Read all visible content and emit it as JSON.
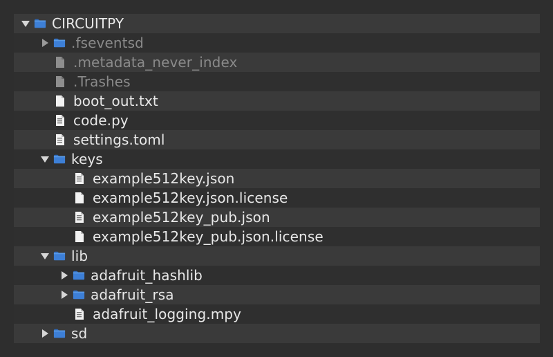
{
  "colors": {
    "folder": "#3d7fd6",
    "row_even": "#3a3a3a",
    "row_odd": "#2f2f2f",
    "text": "#e8e8e8",
    "text_dim": "#8a8a8a"
  },
  "tree": [
    {
      "label": "CIRCUITPY",
      "depth": 0,
      "kind": "folder",
      "state": "expanded",
      "dim": false
    },
    {
      "label": ".fseventsd",
      "depth": 1,
      "kind": "folder",
      "state": "collapsed",
      "dim": true
    },
    {
      "label": ".metadata_never_index",
      "depth": 1,
      "kind": "file",
      "dim": true
    },
    {
      "label": ".Trashes",
      "depth": 1,
      "kind": "file",
      "dim": true
    },
    {
      "label": "boot_out.txt",
      "depth": 1,
      "kind": "file",
      "dim": false
    },
    {
      "label": "code.py",
      "depth": 1,
      "kind": "code",
      "dim": false
    },
    {
      "label": "settings.toml",
      "depth": 1,
      "kind": "code",
      "dim": false
    },
    {
      "label": "keys",
      "depth": 1,
      "kind": "folder",
      "state": "expanded",
      "dim": false
    },
    {
      "label": "example512key.json",
      "depth": 2,
      "kind": "code",
      "dim": false
    },
    {
      "label": "example512key.json.license",
      "depth": 2,
      "kind": "file",
      "dim": false
    },
    {
      "label": "example512key_pub.json",
      "depth": 2,
      "kind": "code",
      "dim": false
    },
    {
      "label": "example512key_pub.json.license",
      "depth": 2,
      "kind": "file",
      "dim": false
    },
    {
      "label": "lib",
      "depth": 1,
      "kind": "folder",
      "state": "expanded",
      "dim": false
    },
    {
      "label": "adafruit_hashlib",
      "depth": 2,
      "kind": "folder",
      "state": "collapsed",
      "dim": false
    },
    {
      "label": "adafruit_rsa",
      "depth": 2,
      "kind": "folder",
      "state": "collapsed",
      "dim": false
    },
    {
      "label": "adafruit_logging.mpy",
      "depth": 2,
      "kind": "code",
      "dim": false
    },
    {
      "label": "sd",
      "depth": 1,
      "kind": "folder",
      "state": "collapsed",
      "dim": false
    }
  ]
}
